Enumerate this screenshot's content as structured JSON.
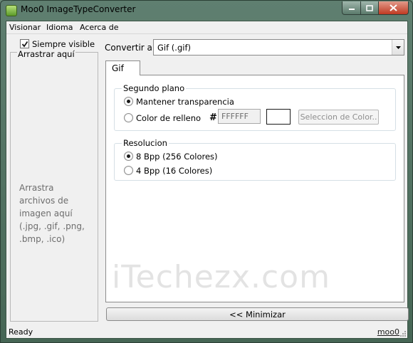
{
  "window": {
    "title": "Moo0 ImageTypeConverter",
    "controls": {
      "minimize": "minimize-icon",
      "maximize": "maximize-icon",
      "close": "close-icon"
    }
  },
  "menu": [
    "Visionar",
    "Idioma",
    "Acerca de"
  ],
  "drop_panel": {
    "always_visible_label": "Siempre visible",
    "always_visible_checked": true,
    "title": "Arrastrar aquí",
    "hint": "Arrastra\narchivos de\nimagen aquí\n(.jpg, .gif, .png,\n.bmp, .ico)"
  },
  "convert": {
    "label": "Convertir a:",
    "selected": "Gif (.gif)"
  },
  "tab": {
    "label": "Gif"
  },
  "background_group": {
    "title": "Segundo plano",
    "keep_transparency": "Mantener transparencia",
    "fill_color": "Color de relleno",
    "selected": "keep_transparency",
    "hash": "#",
    "hex_value": "FFFFFF",
    "color_button": "Seleccion de Color..",
    "swatch_color": "#ffffff"
  },
  "resolution_group": {
    "title": "Resolucion",
    "options": [
      "8 Bpp (256 Colores)",
      "4 Bpp (16 Colores)"
    ],
    "selected_index": 0
  },
  "watermark": "iTechezx.com",
  "minimize_button": "<< Minimizar",
  "status": {
    "left": "Ready",
    "right": "moo0"
  }
}
